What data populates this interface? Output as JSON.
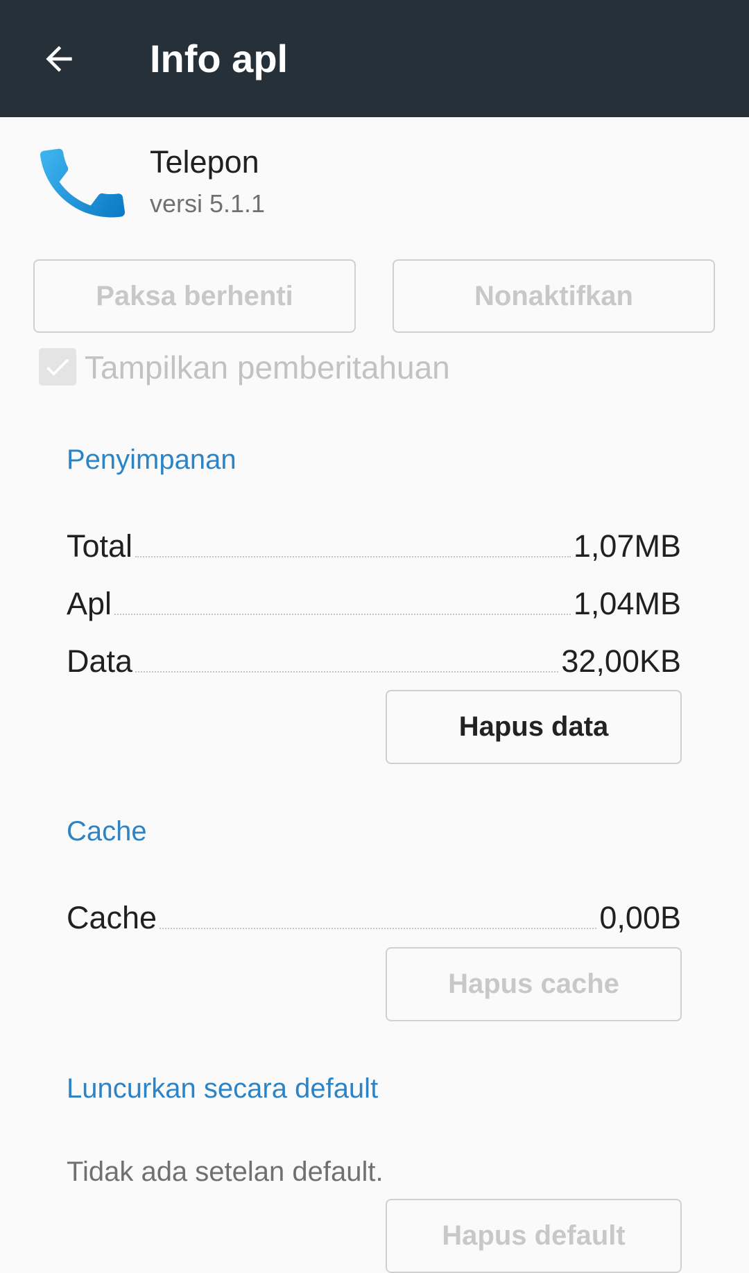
{
  "appbar": {
    "title": "Info apl",
    "back_icon": "arrow-left-icon"
  },
  "app": {
    "name": "Telepon",
    "version": "versi 5.1.1",
    "icon": "phone-handset-icon",
    "icon_color": "#1a9ee6"
  },
  "actions": {
    "force_stop_label": "Paksa berhenti",
    "disable_label": "Nonaktifkan"
  },
  "notifications": {
    "label": "Tampilkan pemberitahuan",
    "checked": true
  },
  "storage": {
    "header": "Penyimpanan",
    "rows": [
      {
        "label": "Total",
        "value": "1,07MB"
      },
      {
        "label": "Apl",
        "value": "1,04MB"
      },
      {
        "label": "Data",
        "value": "32,00KB"
      }
    ],
    "clear_data_label": "Hapus data"
  },
  "cache": {
    "header": "Cache",
    "rows": [
      {
        "label": "Cache",
        "value": "0,00B"
      }
    ],
    "clear_cache_label": "Hapus cache"
  },
  "launch": {
    "header": "Luncurkan secara default",
    "text": "Tidak ada setelan default.",
    "clear_defaults_label": "Hapus default"
  },
  "colors": {
    "appbar_bg": "#263038",
    "accent": "#2c84c7",
    "background": "#fafafa"
  }
}
